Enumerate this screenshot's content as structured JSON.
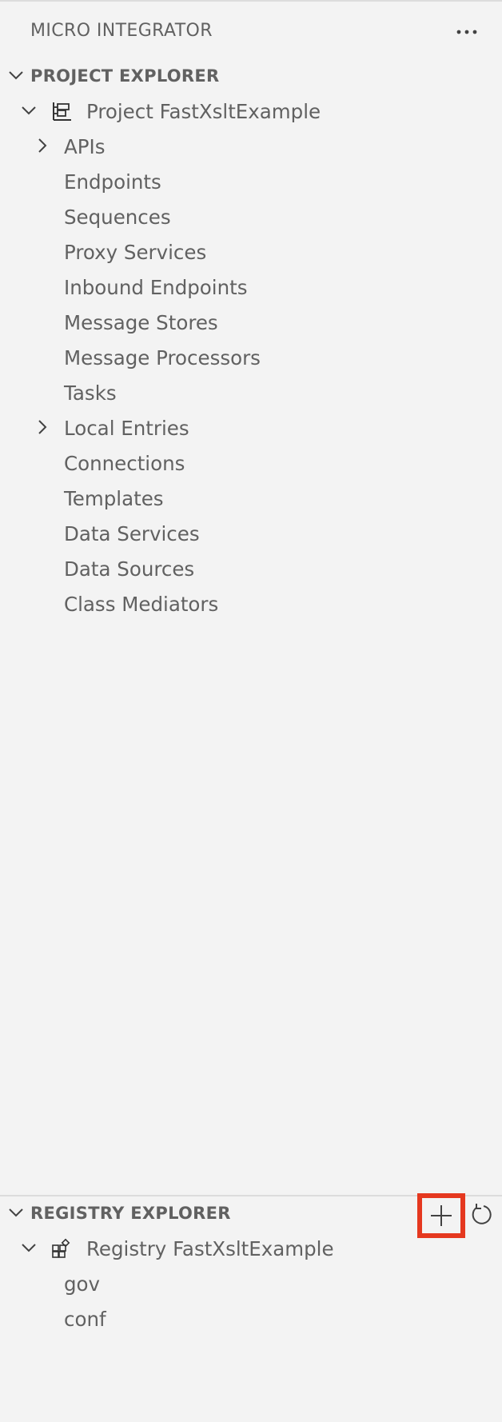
{
  "view": {
    "title": "MICRO INTEGRATOR",
    "more_actions_icon": "ellipsis-icon"
  },
  "project_explorer": {
    "title": "PROJECT EXPLORER",
    "project": {
      "label": "Project FastXsltExample",
      "icon": "project-structure-icon"
    },
    "items": [
      {
        "label": "APIs",
        "expandable": true
      },
      {
        "label": "Endpoints",
        "expandable": false
      },
      {
        "label": "Sequences",
        "expandable": false
      },
      {
        "label": "Proxy Services",
        "expandable": false
      },
      {
        "label": "Inbound Endpoints",
        "expandable": false
      },
      {
        "label": "Message Stores",
        "expandable": false
      },
      {
        "label": "Message Processors",
        "expandable": false
      },
      {
        "label": "Tasks",
        "expandable": false
      },
      {
        "label": "Local Entries",
        "expandable": true
      },
      {
        "label": "Connections",
        "expandable": false
      },
      {
        "label": "Templates",
        "expandable": false
      },
      {
        "label": "Data Services",
        "expandable": false
      },
      {
        "label": "Data Sources",
        "expandable": false
      },
      {
        "label": "Class Mediators",
        "expandable": false
      }
    ]
  },
  "registry_explorer": {
    "title": "REGISTRY EXPLORER",
    "add_icon": "plus-icon",
    "refresh_icon": "refresh-icon",
    "highlight_color": "#e5381f",
    "registry": {
      "label": "Registry FastXsltExample",
      "icon": "registry-icon"
    },
    "items": [
      {
        "label": "gov"
      },
      {
        "label": "conf"
      }
    ]
  }
}
